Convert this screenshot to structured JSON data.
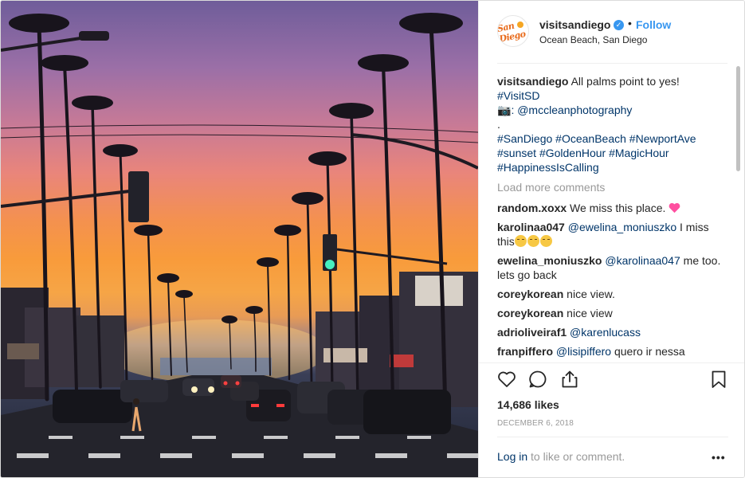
{
  "photo": {
    "alt": "Palm-lined street at sunset in Ocean Beach, San Diego"
  },
  "account": {
    "username": "visitsandiego",
    "avatar_text": "San Diego",
    "verified": true,
    "follow_label": "Follow",
    "location": "Ocean Beach, San Diego",
    "separator": "•"
  },
  "caption": {
    "username": "visitsandiego",
    "text": "All palms point to yes!",
    "hashtag_line1": "#VisitSD",
    "photo_credit_icon": "📷",
    "photo_credit": ": @mccleanphotography",
    "dot": ".",
    "hashtags": [
      "#SanDiego",
      "#OceanBeach",
      "#NewportAve",
      "#sunset",
      "#GoldenHour",
      "#MagicHour",
      "#HappinessIsCalling"
    ]
  },
  "load_more_label": "Load more comments",
  "comments": [
    {
      "username": "random.xoxx",
      "text": "We miss this place.",
      "emoji": "heart"
    },
    {
      "username": "karolinaa047",
      "mention": "@ewelina_moniuszko",
      "text": "I miss this",
      "emoji": "crying-faces"
    },
    {
      "username": "ewelina_moniuszko",
      "mention": "@karolinaa047",
      "text": "me too. lets go back"
    },
    {
      "username": "coreykorean",
      "text": "nice view."
    },
    {
      "username": "coreykorean",
      "text": "nice view"
    },
    {
      "username": "adrioliveiraf1",
      "mention": "@karenlucass"
    },
    {
      "username": "franpiffero",
      "mention": "@lisipiffero",
      "text": "quero ir nessa"
    }
  ],
  "actions": {
    "like_icon": "heart-icon",
    "comment_icon": "comment-icon",
    "share_icon": "share-icon",
    "save_icon": "bookmark-icon"
  },
  "likes_count": "14,686 likes",
  "date": "DECEMBER 6, 2018",
  "footer": {
    "login_link": "Log in",
    "login_text": " to like or comment.",
    "more_label": "•••"
  }
}
